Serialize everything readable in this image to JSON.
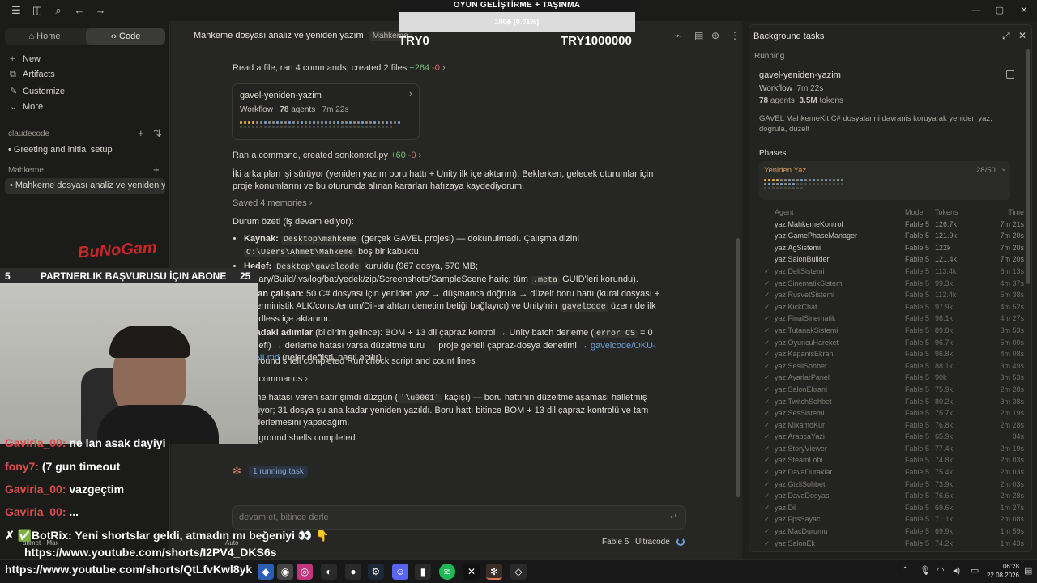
{
  "overlay": {
    "title": "OYUN GELİŞTİRME + TAŞINMA",
    "progress_label": "100₺ (0.01%)",
    "progress_fraction": 0.0001,
    "try_left": "TRY0",
    "try_right": "TRY1000000",
    "logo_text": "BuNoGam",
    "abone_left": "5",
    "abone_text": "PARTNERLIK BAŞVURUSU İÇIN ABONE",
    "abone_right": "25",
    "chat": [
      {
        "user": "Gaviria_00:",
        "text": "ne lan asak dayiyi"
      },
      {
        "user": "fony7:",
        "text": "(7 gun timeout"
      },
      {
        "user": "Gaviria_00:",
        "text": "vazgeçtim"
      },
      {
        "user": "Gaviria_00:",
        "text": "..."
      }
    ],
    "botrix_text": "✗ ✅BotRix: Yeni shortslar geldi, atmadın mı beğeniyi 👀 👇",
    "link1": "https://www.youtube.com/shorts/I2PV4_DKS6s",
    "link2": "https://www.youtube.com/shorts/QtLfvKwl8yk",
    "small_text": "anmet - Max",
    "auto": "Auto"
  },
  "sidebar": {
    "tab_home": "Home",
    "tab_code": "Code",
    "items": [
      {
        "icon": "+",
        "label": "New"
      },
      {
        "icon": "⧉",
        "label": "Artifacts"
      },
      {
        "icon": "✎",
        "label": "Customize"
      },
      {
        "icon": "⌄",
        "label": "More"
      }
    ],
    "section1": "claudecode",
    "chat1": "Greeting and initial setup",
    "section2": "Mahkeme",
    "chat2": "Mahkeme dosyası analiz ve yeniden ya"
  },
  "main": {
    "title": "Mahkeme dosyası analiz ve yeniden yazım",
    "tag": "Mahkeme",
    "line1_text": "Read a file, ran 4 commands, created 2 files",
    "line1_add": "+264",
    "line1_del": "-0",
    "card": {
      "title": "gavel-yeniden-yazim",
      "workflow": "Workflow",
      "agents": "78",
      "agents_label": "agents",
      "time": "7m 22s"
    },
    "line2_text": "Ran a command, created sonkontrol.py",
    "line2_add": "+60",
    "line2_del": "-0",
    "para1": "İki arka plan işi sürüyor (yeniden yazım boru hattı + Unity ilk içe aktarım). Beklerken, gelecek oturumlar için proje konumlarını ve bu oturumda alınan kararları hafızaya kaydediyorum.",
    "saved": "Saved 4 memories",
    "summary_title": "Durum özeti (iş devam ediyor):",
    "b1_label": "Kaynak:",
    "b1_code1": "Desktop\\mahkeme",
    "b1_mid": "(gerçek GAVEL projesi) — dokunulmadı. Çalışma dizini",
    "b1_code2": "C:\\Users\\Ahmet\\Mahkeme",
    "b1_end": "boş bir kabuktu.",
    "b2_label": "Hedef:",
    "b2_code1": "Desktop\\gavelcode",
    "b2_mid": "kuruldu (967 dosya, 570 MB; Library/Build/.vs/log/bat/yedek/zip/Screenshots/SampleScene hariç; tüm",
    "b2_code2": ".meta",
    "b2_end": "GUID'leri korundu).",
    "b3_label": "Şu an çalışan:",
    "b3_text": "50 C# dosyası için yeniden yaz → düşmanca doğrula → düzelt boru hattı (kural dosyası + deterministik ALK/const/enum/Dil-anahtarı denetim betiği bağlayıcı) ve Unity'nin",
    "b3_code": "gavelcode",
    "b3_end": "üzerinde ilk headless içe aktarımı.",
    "b4_label": "Sıradaki adımlar",
    "b4_text": "(bildirim gelince): BOM + 13 dil çapraz kontrol → Unity batch derleme (",
    "b4_code": "error CS",
    "b4_mid": "= 0 hedefi) → derleme hatası varsa düzeltme turu → proje geneli çapraz-dosya denetimi →",
    "b4_link": "gavelcode/OKU-BENI.md",
    "b4_end": "(neler değişti, nasıl açılır).",
    "bg1": "Background shell completed Run check script and count lines",
    "cmds": "Ran 2 commands",
    "para2_a": "Derleme hatası veren satır şimdi düzgün (",
    "para2_code": "'\\u0001'",
    "para2_b": "kaçışı) — boru hattının düzeltme aşaması halletmiş görünüyor; 31 dosya şu ana kadar yeniden yazıldı. Boru hattı bitince BOM + 13 dil çapraz kontrolü ve tam Unity derlemesini yapacağım.",
    "bg2": "2 background shells completed",
    "running_task": "1 running task",
    "input_placeholder": "devam et, bitince derle",
    "model": "Fable 5",
    "mode": "Ultracode"
  },
  "rpanel": {
    "title": "Background tasks",
    "running_label": "Running",
    "wf_title": "gavel-yeniden-yazim",
    "wf_type": "Workflow",
    "wf_time": "7m 22s",
    "wf_agents": "78",
    "wf_agents_label": "agents",
    "wf_tokens": "3.5M",
    "wf_tokens_label": "tokens",
    "wf_desc": "GAVEL MahkemeKit C# dosyalarini davranis koruyarak yeniden yaz, dogrula, duzelt",
    "phases_label": "Phases",
    "phase_name": "Yeniden Yaz",
    "phase_count": "28/50",
    "col_agent": "Agent",
    "col_model": "Model",
    "col_tokens": "Tokens",
    "col_time": "Time",
    "agents": [
      {
        "name": "yaz:MahkemeKontrol",
        "model": "Fable 5",
        "tokens": "126.7k",
        "time": "7m 21s",
        "done": false
      },
      {
        "name": "yaz:GamePhaseManager",
        "model": "Fable 5",
        "tokens": "121.9k",
        "time": "7m 20s",
        "done": false
      },
      {
        "name": "yaz:AgSistemi",
        "model": "Fable 5",
        "tokens": "122k",
        "time": "7m 20s",
        "done": false
      },
      {
        "name": "yaz:SalonBuilder",
        "model": "Fable 5",
        "tokens": "121.4k",
        "time": "7m 20s",
        "done": false
      },
      {
        "name": "yaz:DeliSistemi",
        "model": "Fable 5",
        "tokens": "113.4k",
        "time": "6m 13s",
        "done": true
      },
      {
        "name": "yaz:SinematikSistemi",
        "model": "Fable 5",
        "tokens": "99.3k",
        "time": "4m 37s",
        "done": true
      },
      {
        "name": "yaz:RusvetSistemi",
        "model": "Fable 5",
        "tokens": "112.4k",
        "time": "5m 38s",
        "done": true
      },
      {
        "name": "yaz:KickChat",
        "model": "Fable 5",
        "tokens": "97.9k",
        "time": "4m 52s",
        "done": true
      },
      {
        "name": "yaz:FinalSinematik",
        "model": "Fable 5",
        "tokens": "98.1k",
        "time": "4m 27s",
        "done": true
      },
      {
        "name": "yaz:TutanakSistemi",
        "model": "Fable 5",
        "tokens": "89.8k",
        "time": "3m 53s",
        "done": true
      },
      {
        "name": "yaz:OyuncuHareket",
        "model": "Fable 5",
        "tokens": "96.7k",
        "time": "5m 00s",
        "done": true
      },
      {
        "name": "yaz:KapanisEkrani",
        "model": "Fable 5",
        "tokens": "96.8k",
        "time": "4m 08s",
        "done": true
      },
      {
        "name": "yaz:SesliSohbet",
        "model": "Fable 5",
        "tokens": "88.1k",
        "time": "3m 49s",
        "done": true
      },
      {
        "name": "yaz:AyarlarPanel",
        "model": "Fable 5",
        "tokens": "90k",
        "time": "3m 53s",
        "done": true
      },
      {
        "name": "yaz:SalonEkrani",
        "model": "Fable 5",
        "tokens": "75.9k",
        "time": "2m 28s",
        "done": true
      },
      {
        "name": "yaz:TwitchSohbet",
        "model": "Fable 5",
        "tokens": "80.2k",
        "time": "3m 38s",
        "done": true
      },
      {
        "name": "yaz:SesSistemi",
        "model": "Fable 5",
        "tokens": "75.7k",
        "time": "2m 19s",
        "done": true
      },
      {
        "name": "yaz:MixamoKur",
        "model": "Fable 5",
        "tokens": "76.8k",
        "time": "2m 28s",
        "done": true
      },
      {
        "name": "yaz:ArapcaYazi",
        "model": "Fable 5",
        "tokens": "65.9k",
        "time": "34s",
        "done": true
      },
      {
        "name": "yaz:StoryViewer",
        "model": "Fable 5",
        "tokens": "77.4k",
        "time": "2m 19s",
        "done": true
      },
      {
        "name": "yaz:SteamLobi",
        "model": "Fable 5",
        "tokens": "74.8k",
        "time": "2m 03s",
        "done": true
      },
      {
        "name": "yaz:DavaDuraklat",
        "model": "Fable 5",
        "tokens": "75.4k",
        "time": "2m 03s",
        "done": true
      },
      {
        "name": "yaz:GizliSohbet",
        "model": "Fable 5",
        "tokens": "73.9k",
        "time": "2m 03s",
        "done": true
      },
      {
        "name": "yaz:DavaDosyasi",
        "model": "Fable 5",
        "tokens": "76.6k",
        "time": "2m 28s",
        "done": true
      },
      {
        "name": "yaz:Dil",
        "model": "Fable 5",
        "tokens": "69.6k",
        "time": "1m 27s",
        "done": true
      },
      {
        "name": "yaz:FpsSayac",
        "model": "Fable 5",
        "tokens": "71.1k",
        "time": "2m 08s",
        "done": true
      },
      {
        "name": "yaz:MacDurumu",
        "model": "Fable 5",
        "tokens": "69.9k",
        "time": "1m 59s",
        "done": true
      },
      {
        "name": "yaz:SalonEk",
        "model": "Fable 5",
        "tokens": "74.2k",
        "time": "1m 43s",
        "done": true
      }
    ]
  },
  "taskbar": {
    "time": "06:28",
    "date": "22.08.2026"
  }
}
